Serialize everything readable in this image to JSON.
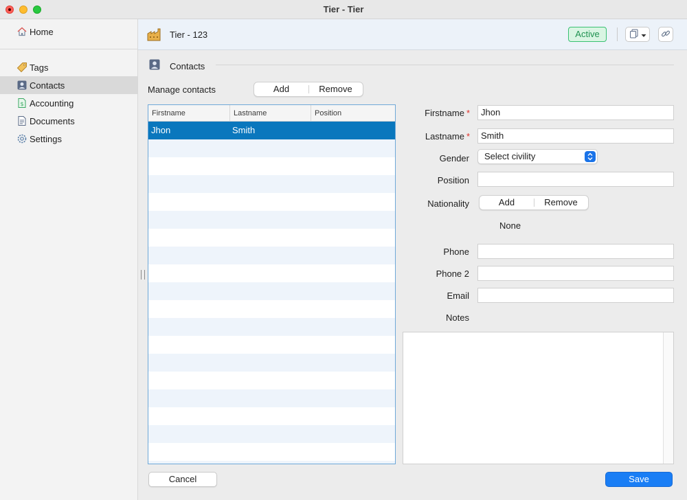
{
  "window": {
    "title": "Tier - Tier"
  },
  "sidebar": {
    "items": [
      {
        "label": "Home",
        "icon": "home-icon"
      },
      {
        "label": "Tags",
        "icon": "tag-icon"
      },
      {
        "label": "Contacts",
        "icon": "contact-icon",
        "selected": true
      },
      {
        "label": "Accounting",
        "icon": "accounting-icon"
      },
      {
        "label": "Documents",
        "icon": "document-icon"
      },
      {
        "label": "Settings",
        "icon": "gear-icon"
      }
    ]
  },
  "header": {
    "title": "Tier - 123",
    "status": "Active",
    "icon": "factory-icon"
  },
  "section": {
    "title": "Contacts"
  },
  "contacts": {
    "manage_label": "Manage contacts",
    "add_label": "Add",
    "remove_label": "Remove",
    "columns": [
      "Firstname",
      "Lastname",
      "Position"
    ],
    "rows": [
      {
        "firstname": "Jhon",
        "lastname": "Smith",
        "position": ""
      }
    ]
  },
  "form": {
    "firstname_label": "Firstname",
    "firstname_value": "Jhon",
    "lastname_label": "Lastname",
    "lastname_value": "Smith",
    "required_mark": "*",
    "gender_label": "Gender",
    "gender_value": "Select civility",
    "position_label": "Position",
    "position_value": "",
    "nationality_label": "Nationality",
    "nationality_add": "Add",
    "nationality_remove": "Remove",
    "nationality_value": "None",
    "phone_label": "Phone",
    "phone_value": "",
    "phone2_label": "Phone 2",
    "phone2_value": "",
    "email_label": "Email",
    "email_value": "",
    "notes_label": "Notes",
    "notes_value": ""
  },
  "footer": {
    "cancel_label": "Cancel",
    "save_label": "Save"
  },
  "colors": {
    "accent": "#1a7ef5",
    "selection": "#0a77bd",
    "active_badge": "#38c071"
  }
}
